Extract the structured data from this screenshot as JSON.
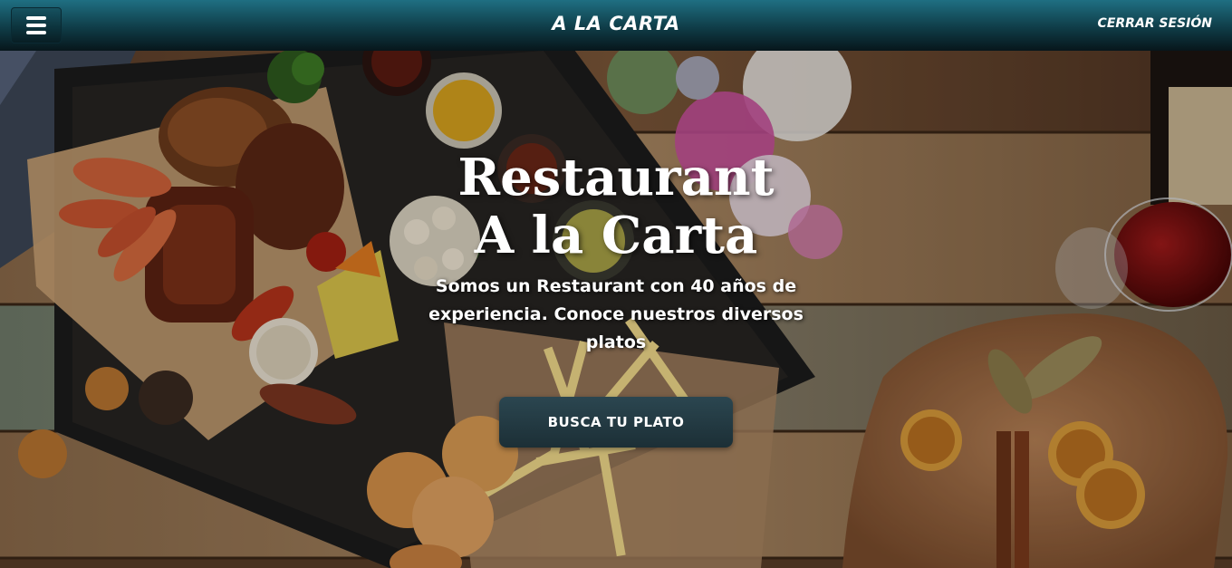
{
  "navbar": {
    "brand": "A LA CARTA",
    "logout_label": "CERRAR SESIÓN",
    "menu_icon": "hamburger-menu-icon"
  },
  "hero": {
    "title_line1": "Restaurant",
    "title_line2": "A la Carta",
    "subtitle": "Somos un Restaurant con 40 años de experiencia. Conoce nuestros diversos platos",
    "button_label": "BUSCA TU PLATO",
    "background": "wooden-table-food-photo"
  },
  "colors": {
    "navbar_top": "#1f6f82",
    "navbar_bottom": "#07161b",
    "button": "#2b4650",
    "text": "#ffffff"
  }
}
